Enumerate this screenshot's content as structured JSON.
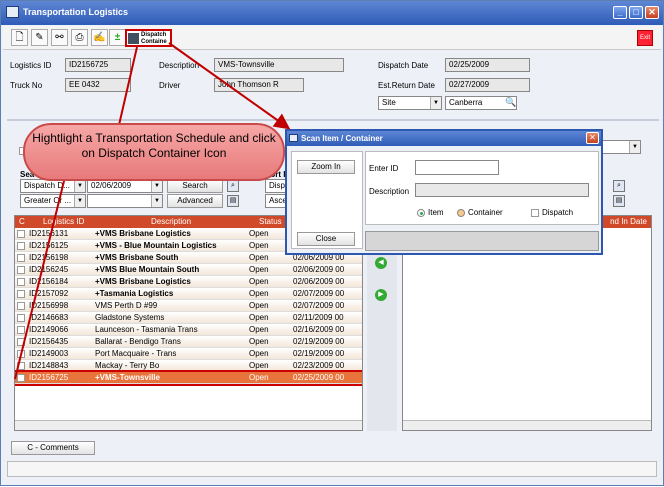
{
  "window": {
    "title": "Transportation Logistics"
  },
  "toolbar": {
    "dispatch_line1": "Dispatch",
    "dispatch_line2": "Containe",
    "exit_icon": "exit-icon"
  },
  "header": {
    "logistics_id_label": "Logistics ID",
    "logistics_id": "ID2156725",
    "description_label": "Description",
    "description": "VMS-Townsville",
    "dispatch_date_label": "Dispatch Date",
    "dispatch_date": "02/25/2009",
    "truck_no_label": "Truck No",
    "truck_no": "EE 0432",
    "driver_label": "Driver",
    "driver": "John Thomson R",
    "est_return_label": "Est.Return Date",
    "est_return": "02/27/2009",
    "site_select": "Site",
    "site_value": "Canberra"
  },
  "search": {
    "label": "Sea",
    "field": "Dispatch D...",
    "date": "02/06/2009",
    "operator": "Greater Or ...",
    "search_btn": "Search",
    "advanced_btn": "Advanced",
    "sort_label": "Sort I",
    "sort_field": "Disp",
    "sort_order": "Asce"
  },
  "grid": {
    "columns": [
      "C",
      "Logistics ID",
      "Description",
      "Status",
      "D"
    ],
    "rows": [
      {
        "id": "ID2156131",
        "desc": "+VMS Brisbane Logistics",
        "status": "Open",
        "date": "02/06/2009 00"
      },
      {
        "id": "ID2156125",
        "desc": "+VMS - Blue Mountain Logistics",
        "status": "Open",
        "date": "02/06/2009 00"
      },
      {
        "id": "ID2156198",
        "desc": "+VMS Brisbane South",
        "status": "Open",
        "date": "02/06/2009 00"
      },
      {
        "id": "ID2156245",
        "desc": "+VMS Blue Mountain South",
        "status": "Open",
        "date": "02/06/2009 00"
      },
      {
        "id": "ID2156184",
        "desc": "+VMS Brisbane Logistics",
        "status": "Open",
        "date": "02/06/2009 00"
      },
      {
        "id": "ID2157092",
        "desc": "+Tasmania Logistics",
        "status": "Open",
        "date": "02/07/2009 00"
      },
      {
        "id": "ID2156998",
        "desc": "VMS Perth D #99",
        "status": "Open",
        "date": "02/07/2009 00"
      },
      {
        "id": "ID2146683",
        "desc": "Gladstone Systems",
        "status": "Open",
        "date": "02/11/2009 00"
      },
      {
        "id": "ID2149066",
        "desc": "Launceson - Tasmania Trans",
        "status": "Open",
        "date": "02/16/2009 00"
      },
      {
        "id": "ID2156435",
        "desc": "Ballarat - Bendigo Trans",
        "status": "Open",
        "date": "02/19/2009 00"
      },
      {
        "id": "ID2149003",
        "desc": "Port Macquaire - Trans",
        "status": "Open",
        "date": "02/19/2009 00"
      },
      {
        "id": "ID2148843",
        "desc": "Mackay - Terry Bo",
        "status": "Open",
        "date": "02/23/2009 00"
      },
      {
        "id": "ID2156725",
        "desc": "+VMS-Townsville",
        "status": "Open",
        "date": "02/25/2009 00"
      }
    ]
  },
  "right_grid": {
    "header_tail": "nd In Date"
  },
  "dialog": {
    "title": "Scan Item / Container",
    "zoom_in": "Zoom In",
    "close": "Close",
    "enter_id_label": "Enter ID",
    "description_label": "Description",
    "radio_item": "Item",
    "radio_container": "Container",
    "check_dispatch": "Dispatch"
  },
  "callout": {
    "text": "Hightlight a Transportation Schedule and click on Dispatch Container Icon"
  },
  "footer": {
    "comments_tab": "C - Comments"
  },
  "colors": {
    "title_blue": "#2f5cb8",
    "grid_header": "#d04a2a",
    "selected_row": "#e8743c",
    "callout": "#f08a8a",
    "arrow": "#c00000"
  }
}
